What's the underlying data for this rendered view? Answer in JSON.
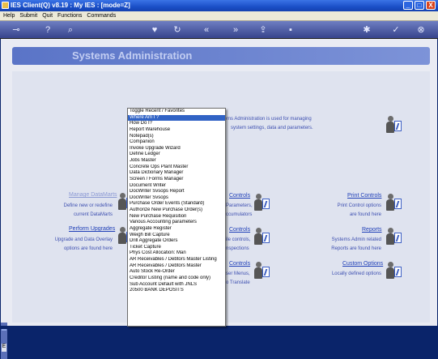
{
  "window": {
    "title": "IES Client(Q) v8.19 : My IES :       [mode=Z]",
    "minimize": "_",
    "maximize": "□",
    "close": "X"
  },
  "menu": [
    "Help",
    "Submit",
    "Quit",
    "Functions",
    "Commands"
  ],
  "toolbar_icons": [
    "key-icon",
    "help-icon",
    "search-icon",
    "heart-icon",
    "refresh-icon",
    "rewind-icon",
    "fast-forward-icon",
    "export-icon",
    "save-icon",
    "settings-icon",
    "check-icon",
    "cancel-icon"
  ],
  "banner": {
    "title": "Systems Administration"
  },
  "info": {
    "line1": "Systems Administration is used for managing",
    "line2": "system settings, data and parameters."
  },
  "left": {
    "datamarts": {
      "link": "Manage DataMarts",
      "line1": "Define new or redefine",
      "line2": "current DataMarts"
    },
    "upgrades": {
      "link": "Perform Upgrades",
      "line1": "Upgrade and Data Overlay",
      "line2": "options are found here"
    }
  },
  "middle": {
    "controls": {
      "link": "Controls",
      "line1": "Parameters,",
      "line2": "ccumulators"
    },
    "controls2": {
      "link": "Controls",
      "line1": "ile controls,",
      "line2": "nspections"
    },
    "controls3": {
      "link": "Controls",
      "line1": "ser Menus,",
      "line2": "o Translate"
    }
  },
  "right": {
    "print": {
      "link": "Print Controls",
      "line1": "Print Control options",
      "line2": "are found here"
    },
    "reports": {
      "link": "Reports",
      "line1": "Systems Admin related",
      "line2": "Reports are found here"
    },
    "custom": {
      "link": "Custom Options",
      "line1": "Locally defined options"
    }
  },
  "sidestrip": {
    "label": "E"
  },
  "dropdown": {
    "selected_index": 1,
    "items": [
      "Toggle Recent / Favorites",
      "Where Am I ?",
      "How Do I?",
      "Report Warehouse",
      "Notepad(s)",
      "Companion",
      "Invoke Upgrade Wizard",
      "Define Ledger",
      "Jobs Master",
      "Concrete Ops Plant Master",
      "Data Dictionary Manager",
      "Screen / Forms Manager",
      "Document Writer",
      "DocWriter Svsops Report",
      "DocWriter Svsops",
      "Purchase Order Events (Standard)",
      "Authorize New Purchase Order(s)",
      "New Purchase Requisition",
      "Various Accounting parameters",
      "Aggregate Register",
      "Weigh Bill Capture",
      "Drill Aggregate Orders",
      "Ticket Capture",
      "Phys Cost Allocation: Man",
      "AR Receivables / Debtors Master Listing",
      "AR Receivables / Debtors Master",
      "Auto Stock Re-Order",
      "Creditor Listing (name and code only)",
      "Sub Account Default with JNLS",
      "20500 BANK DEPOSITS"
    ]
  }
}
